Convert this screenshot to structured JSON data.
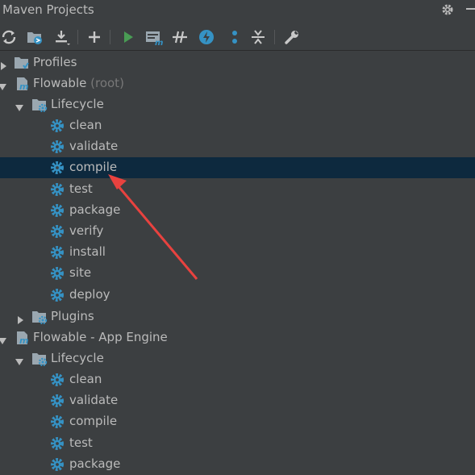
{
  "panel": {
    "title": "Maven Projects"
  },
  "toolbar": {
    "buttons": [
      {
        "name": "reimport-all-icon"
      },
      {
        "name": "generate-sources-icon"
      },
      {
        "name": "download-icon"
      },
      {
        "name": "add-project-icon"
      },
      {
        "name": "run-maven-build-icon"
      },
      {
        "name": "execute-maven-goal-icon"
      },
      {
        "name": "toggle-offline-icon"
      },
      {
        "name": "skip-tests-icon"
      },
      {
        "name": "show-dependencies-icon"
      },
      {
        "name": "collapse-all-icon"
      },
      {
        "name": "maven-settings-icon"
      }
    ]
  },
  "tree": {
    "profiles": "Profiles",
    "project1": {
      "name": "Flowable",
      "suffix": "(root)"
    },
    "lifecycle_label": "Lifecycle",
    "plugins_label": "Plugins",
    "project2": {
      "name": "Flowable - App Engine"
    },
    "goals1": [
      "clean",
      "validate",
      "compile",
      "test",
      "package",
      "verify",
      "install",
      "site",
      "deploy"
    ],
    "goals2": [
      "clean",
      "validate",
      "compile",
      "test",
      "package"
    ]
  },
  "selected_goal": "compile",
  "colors": {
    "background": "#3c3f41",
    "selection": "#0d293e",
    "gear_blue": "#3592c4",
    "text": "#bbbbbb",
    "annotation_arrow": "#e8423f"
  }
}
